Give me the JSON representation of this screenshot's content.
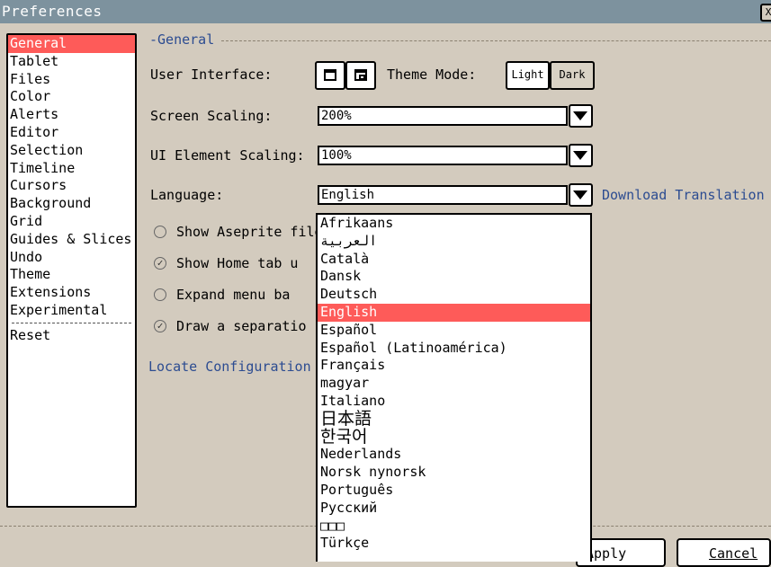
{
  "window": {
    "title": "Preferences",
    "close_glyph": "X"
  },
  "sidebar": {
    "items": [
      {
        "label": "General",
        "selected": true
      },
      {
        "label": "Tablet"
      },
      {
        "label": "Files"
      },
      {
        "label": "Color"
      },
      {
        "label": "Alerts"
      },
      {
        "label": "Editor"
      },
      {
        "label": "Selection"
      },
      {
        "label": "Timeline"
      },
      {
        "label": "Cursors"
      },
      {
        "label": "Background"
      },
      {
        "label": "Grid"
      },
      {
        "label": "Guides & Slices"
      },
      {
        "label": "Undo"
      },
      {
        "label": "Theme"
      },
      {
        "label": "Extensions"
      },
      {
        "label": "Experimental"
      }
    ],
    "reset_label": "Reset"
  },
  "general": {
    "group_title": "General",
    "user_interface_label": "User Interface:",
    "theme_mode_label": "Theme Mode:",
    "theme_light": "Light",
    "theme_dark": "Dark",
    "screen_scaling_label": "Screen Scaling:",
    "screen_scaling_value": "200%",
    "ui_element_scaling_label": "UI Element Scaling:",
    "ui_element_scaling_value": "100%",
    "language_label": "Language:",
    "language_value": "English",
    "download_translation": "Download Translation",
    "checks": [
      {
        "label": "Show Aseprite file",
        "checked": false
      },
      {
        "label": "Show Home tab u",
        "checked": true
      },
      {
        "label": "Expand menu ba",
        "checked": false
      },
      {
        "label": "Draw a separatio",
        "checked": true
      }
    ],
    "locate_config": "Locate Configuration"
  },
  "language_options": [
    "Afrikaans",
    "العربية",
    "Català",
    "Dansk",
    "Deutsch",
    "English",
    "Español",
    "Español (Latinoamérica)",
    "Français",
    "magyar",
    "Italiano",
    "日本語",
    "한국어",
    "Nederlands",
    "Norsk nynorsk",
    "Português",
    "Русский",
    "□□□",
    "Türkçe"
  ],
  "language_selected_index": 5,
  "buttons": {
    "apply": "Apply",
    "cancel": "Cancel"
  },
  "colors": {
    "titlebar": "#7d929e",
    "selection": "#fe5b59",
    "link": "#2c4c91",
    "background": "#d3cbbe"
  }
}
